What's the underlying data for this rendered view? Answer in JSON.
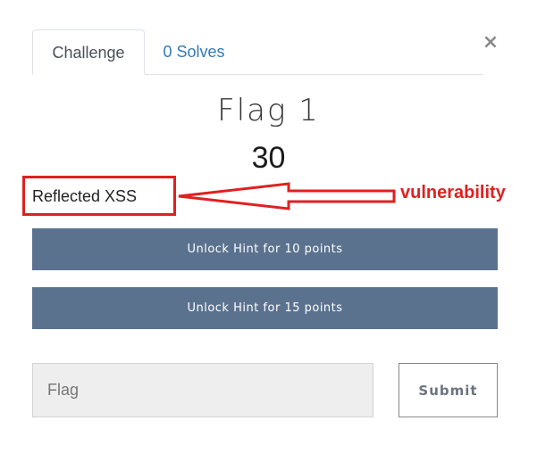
{
  "tabs": {
    "challenge_label": "Challenge",
    "solves_label": "0 Solves"
  },
  "close_label": "×",
  "challenge": {
    "name": "Flag 1",
    "value": "30",
    "description": "Reflected XSS"
  },
  "annotation": {
    "label": "vulnerability",
    "color": "#e02020"
  },
  "hints": [
    {
      "label": "Unlock Hint for 10 points"
    },
    {
      "label": "Unlock Hint for 15 points"
    }
  ],
  "submission": {
    "placeholder": "Flag",
    "submit_label": "Submit"
  },
  "colors": {
    "hint_button": "#5b728f",
    "link": "#337ab7",
    "annotation": "#e02020"
  }
}
